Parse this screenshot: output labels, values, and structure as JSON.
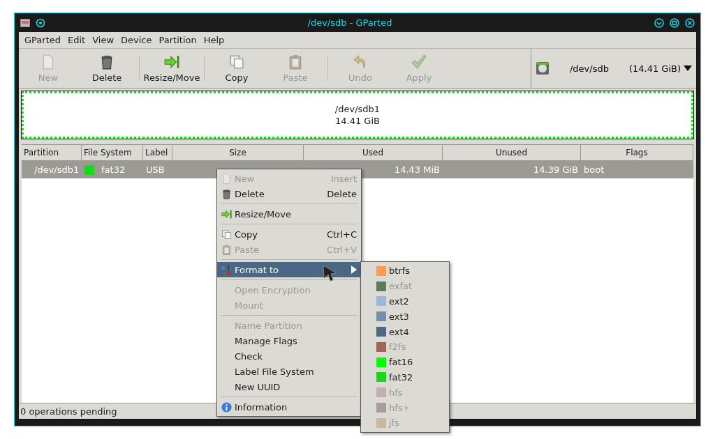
{
  "window": {
    "title": "/dev/sdb - GParted"
  },
  "menubar": [
    "GParted",
    "Edit",
    "View",
    "Device",
    "Partition",
    "Help"
  ],
  "toolbar": {
    "groups": [
      [
        {
          "kind": "new",
          "label": "New",
          "disabled": true
        },
        {
          "kind": "delete",
          "label": "Delete",
          "disabled": false
        }
      ],
      [
        {
          "kind": "resize",
          "label": "Resize/Move",
          "disabled": false
        }
      ],
      [
        {
          "kind": "copy",
          "label": "Copy",
          "disabled": false
        },
        {
          "kind": "paste",
          "label": "Paste",
          "disabled": true
        }
      ],
      [
        {
          "kind": "undo",
          "label": "Undo",
          "disabled": true
        },
        {
          "kind": "apply",
          "label": "Apply",
          "disabled": true
        }
      ]
    ]
  },
  "device_selector": {
    "device": "/dev/sdb",
    "size": "(14.41 GiB)"
  },
  "disk_map": {
    "partition": "/dev/sdb1",
    "size": "14.41 GiB"
  },
  "table": {
    "columns": [
      "Partition",
      "File System",
      "Label",
      "Size",
      "Used",
      "Unused",
      "Flags"
    ],
    "rows": [
      {
        "partition": "/dev/sdb1",
        "color": "#18d918",
        "file_system": "fat32",
        "label": "USB",
        "used": "14.43 MiB",
        "unused": "14.39 GiB",
        "flags": "boot",
        "selected": true
      }
    ]
  },
  "context_menu": {
    "items": [
      {
        "kind": "item",
        "label": "New",
        "shortcut": "Insert",
        "disabled": true,
        "selected": false
      },
      {
        "kind": "item",
        "label": "Delete",
        "shortcut": "Delete",
        "disabled": false,
        "selected": false
      },
      {
        "kind": "separator"
      },
      {
        "kind": "item",
        "label": "Resize/Move",
        "disabled": false,
        "selected": false
      },
      {
        "kind": "separator"
      },
      {
        "kind": "item",
        "label": "Copy",
        "shortcut": "Ctrl+C",
        "disabled": false,
        "selected": false
      },
      {
        "kind": "item",
        "label": "Paste",
        "shortcut": "Ctrl+V",
        "disabled": true,
        "selected": false
      },
      {
        "kind": "separator"
      },
      {
        "kind": "submenu",
        "label": "Format to",
        "disabled": false,
        "selected": true
      },
      {
        "kind": "separator"
      },
      {
        "kind": "item",
        "label": "Open Encryption",
        "disabled": true,
        "selected": false
      },
      {
        "kind": "item",
        "label": "Mount",
        "disabled": true,
        "selected": false
      },
      {
        "kind": "separator"
      },
      {
        "kind": "item",
        "label": "Name Partition",
        "disabled": true,
        "selected": false
      },
      {
        "kind": "item",
        "label": "Manage Flags",
        "disabled": false,
        "selected": false
      },
      {
        "kind": "item",
        "label": "Check",
        "disabled": false,
        "selected": false
      },
      {
        "kind": "item",
        "label": "Label File System",
        "disabled": false,
        "selected": false
      },
      {
        "kind": "item",
        "label": "New UUID",
        "disabled": false,
        "selected": false
      },
      {
        "kind": "separator"
      },
      {
        "kind": "item",
        "label": "Information",
        "disabled": false,
        "selected": false
      }
    ]
  },
  "format_submenu": [
    {
      "label": "btrfs",
      "color": "#ff9955",
      "disabled": false
    },
    {
      "label": "exfat",
      "color": "#5e7a5e",
      "disabled": true
    },
    {
      "label": "ext2",
      "color": "#9cb8d8",
      "disabled": false
    },
    {
      "label": "ext3",
      "color": "#7590ae",
      "disabled": false
    },
    {
      "label": "ext4",
      "color": "#4b6983",
      "disabled": false
    },
    {
      "label": "f2fs",
      "color": "#a0665b",
      "disabled": true
    },
    {
      "label": "fat16",
      "color": "#00ff00",
      "disabled": false
    },
    {
      "label": "fat32",
      "color": "#18d918",
      "disabled": false
    },
    {
      "label": "hfs",
      "color": "#c0b0b0",
      "disabled": true
    },
    {
      "label": "hfs+",
      "color": "#a89c9c",
      "disabled": true
    },
    {
      "label": "jfs",
      "color": "#c8b8a0",
      "disabled": true
    }
  ],
  "status_bar": "0 operations pending"
}
